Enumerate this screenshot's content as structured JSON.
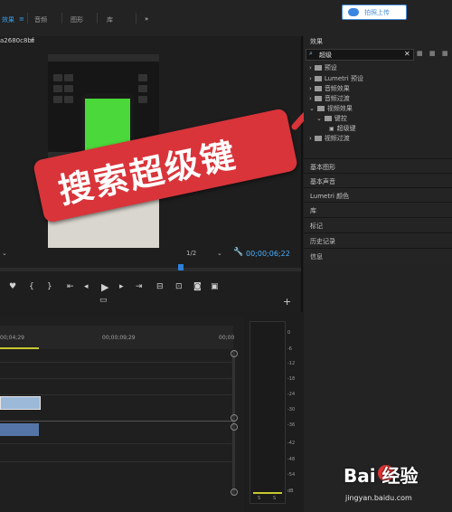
{
  "topbar": {
    "tabs": [
      "效果",
      "音频",
      "图形",
      "库"
    ],
    "menu_glyph": "≡",
    "more_glyph": "»",
    "upload_label": "拍照上传"
  },
  "monitor": {
    "sequence_name": "a2680c8bf",
    "fraction": "1/2",
    "timecode": "00;00;06;22"
  },
  "banner": {
    "text": "搜索超级键"
  },
  "effects": {
    "title": "效果",
    "search_value": "超级",
    "tree": [
      {
        "label": "预设",
        "level": 0
      },
      {
        "label": "Lumetri 预设",
        "level": 0
      },
      {
        "label": "音频效果",
        "level": 0
      },
      {
        "label": "音频过渡",
        "level": 0
      },
      {
        "label": "视频效果",
        "level": 0,
        "open": true
      },
      {
        "label": "键控",
        "level": 1,
        "open": true
      },
      {
        "label": "超级键",
        "level": 2
      },
      {
        "label": "视频过渡",
        "level": 0
      }
    ],
    "sections": [
      "基本图形",
      "基本声音",
      "Lumetri 颜色",
      "库",
      "标记",
      "历史记录",
      "信息"
    ]
  },
  "timeline": {
    "time_a": "00;04;29",
    "time_b": "00;00;09;29",
    "time_c": "00;00"
  },
  "meter": {
    "labels": [
      "0",
      "-6",
      "-12",
      "-18",
      "-24",
      "-30",
      "-36",
      "-42",
      "-48",
      "-54",
      "dB"
    ],
    "channels": [
      "S",
      "S"
    ]
  },
  "watermark": {
    "brand": "Bai 经验",
    "url": "jingyan.baidu.com"
  },
  "colors": {
    "accent": "#3b9ee8",
    "banner": "#d8343a",
    "clip": "#9cb9d9",
    "timecode": "#4ab0ff"
  }
}
